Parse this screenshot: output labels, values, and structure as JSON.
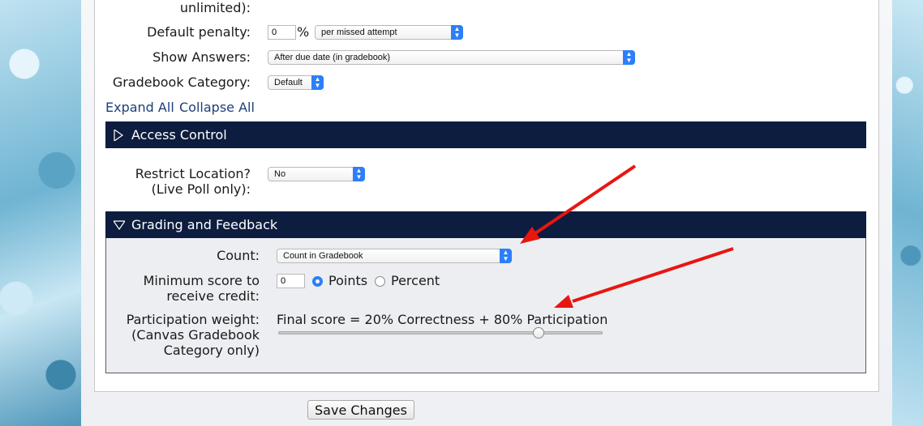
{
  "settings": {
    "unlimited_label": "unlimited):",
    "default_penalty": {
      "label": "Default penalty:",
      "value": "0",
      "unit": "%",
      "mode": "per missed attempt"
    },
    "show_answers": {
      "label": "Show Answers:",
      "value": "After due date (in gradebook)"
    },
    "gradebook_category": {
      "label": "Gradebook Category:",
      "value": "Default"
    },
    "expand_all": "Expand All",
    "collapse_all": "Collapse All"
  },
  "access_control": {
    "title": "Access Control",
    "restrict_label_line1": "Restrict Location?",
    "restrict_label_line2": "(Live Poll only):",
    "restrict_value": "No"
  },
  "grading": {
    "title": "Grading and Feedback",
    "count_label": "Count:",
    "count_value": "Count in Gradebook",
    "min_score_label_line1": "Minimum score to",
    "min_score_label_line2": "receive credit:",
    "min_score_value": "0",
    "points_label": "Points",
    "percent_label": "Percent",
    "selected_unit": "Points",
    "participation_label_line1": "Participation weight:",
    "participation_label_line2": "(Canvas Gradebook",
    "participation_label_line3": "Category only)",
    "formula": "Final score = 20% Correctness + 80% Participation",
    "participation_percent": 80
  },
  "footer": {
    "save_label": "Save Changes"
  },
  "colors": {
    "section_bar": "#0d1d3f",
    "accent": "#2d7ff9",
    "annotation_arrow": "#e8160f"
  }
}
